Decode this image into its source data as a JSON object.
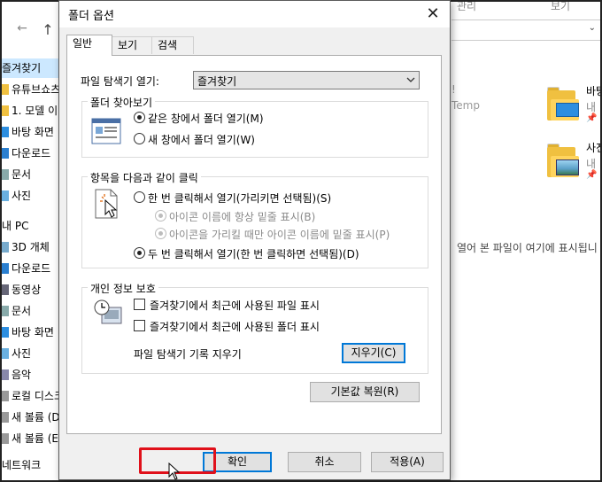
{
  "explorer": {
    "top_tabs": [
      "관리",
      "보기"
    ],
    "sidebar": [
      "즐겨찾기",
      "유튜브쇼츠",
      "1. 모델 이",
      "바탕 화면",
      "다운로드",
      "문서",
      "사진",
      "내 PC",
      "3D 개체",
      "다운로드",
      "동영상",
      "문서",
      "바탕 화면",
      "사진",
      "음악",
      "로컬 디스크",
      "새 볼륨 (D",
      "새 볼륨 (E",
      "네트워크"
    ],
    "folders": [
      {
        "name": "바탕",
        "sub": "내"
      },
      {
        "name": "사진",
        "sub": "내"
      }
    ],
    "faint_temp": "Temp",
    "recent_message": "열어 본 파일이 여기에 표시됩니"
  },
  "dialog": {
    "title": "폴더 옵션",
    "close_glyph": "✕",
    "tabs": [
      "일반",
      "보기",
      "검색"
    ],
    "open_explorer_label": "파일 탐색기 열기:",
    "open_explorer_value": "즐겨찾기",
    "browse_group": {
      "legend": "폴더 찾아보기",
      "options": [
        "같은 창에서 폴더 열기(M)",
        "새 창에서 폴더 열기(W)"
      ]
    },
    "click_group": {
      "legend": "항목을 다음과 같이 클릭",
      "single": "한 번 클릭해서 열기(가리키면 선택됨)(S)",
      "sub_options": [
        "아이콘 이름에 항상 밑줄 표시(B)",
        "아이콘을 가리킬 때만 아이콘 이름에 밑줄 표시(P)"
      ],
      "double": "두 번 클릭해서 열기(한 번 클릭하면 선택됨)(D)"
    },
    "privacy_group": {
      "legend": "개인 정보 보호",
      "checks": [
        "즐겨찾기에서 최근에 사용된 파일 표시",
        "즐겨찾기에서 최근에 사용된 폴더 표시"
      ],
      "clear_label": "파일 탐색기 기록 지우기",
      "clear_button": "지우기(C)"
    },
    "restore_button": "기본값 복원(R)",
    "buttons": {
      "ok": "확인",
      "cancel": "취소",
      "apply": "적용(A)"
    }
  },
  "colors": {
    "highlight": "#e0101a",
    "focus": "#0078d7",
    "selection": "#cce8ff"
  }
}
